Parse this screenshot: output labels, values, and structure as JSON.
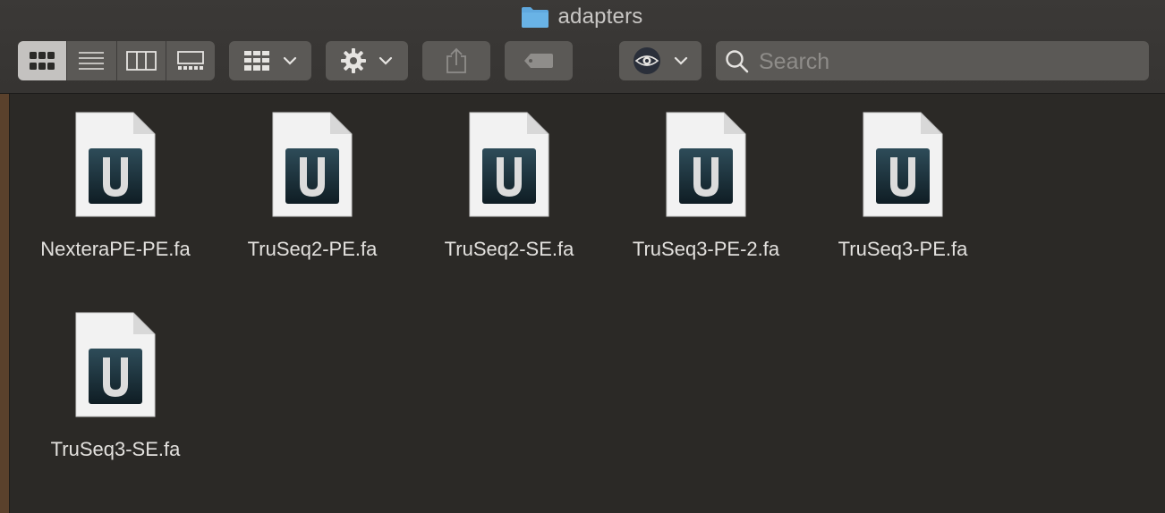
{
  "window": {
    "title": "adapters",
    "title_icon": "folder-icon"
  },
  "toolbar": {
    "view_modes": [
      {
        "name": "icon-view",
        "icon": "grid-icon",
        "active": true
      },
      {
        "name": "list-view",
        "icon": "list-icon",
        "active": false
      },
      {
        "name": "column-view",
        "icon": "columns-icon",
        "active": false
      },
      {
        "name": "gallery-view",
        "icon": "gallery-icon",
        "active": false
      }
    ],
    "group_button_icon": "group-icon",
    "action_button_icon": "gear-icon",
    "share_button_icon": "share-icon",
    "tag_button_icon": "tag-icon",
    "preview_button_icon": "eye-icon"
  },
  "search": {
    "placeholder": "Search"
  },
  "files": [
    {
      "name": "NexteraPE-PE.fa",
      "icon": "ugene-document-icon"
    },
    {
      "name": "TruSeq2-PE.fa",
      "icon": "ugene-document-icon"
    },
    {
      "name": "TruSeq2-SE.fa",
      "icon": "ugene-document-icon"
    },
    {
      "name": "TruSeq3-PE-2.fa",
      "icon": "ugene-document-icon"
    },
    {
      "name": "TruSeq3-PE.fa",
      "icon": "ugene-document-icon"
    },
    {
      "name": "TruSeq3-SE.fa",
      "icon": "ugene-document-icon"
    }
  ],
  "colors": {
    "background": "#2b2926",
    "toolbar": "#3a3836",
    "button": "#5b5956",
    "active_segment": "#c4c2c0",
    "folder_blue": "#5fa8de",
    "doc_icon_dark": "#1c3440"
  }
}
